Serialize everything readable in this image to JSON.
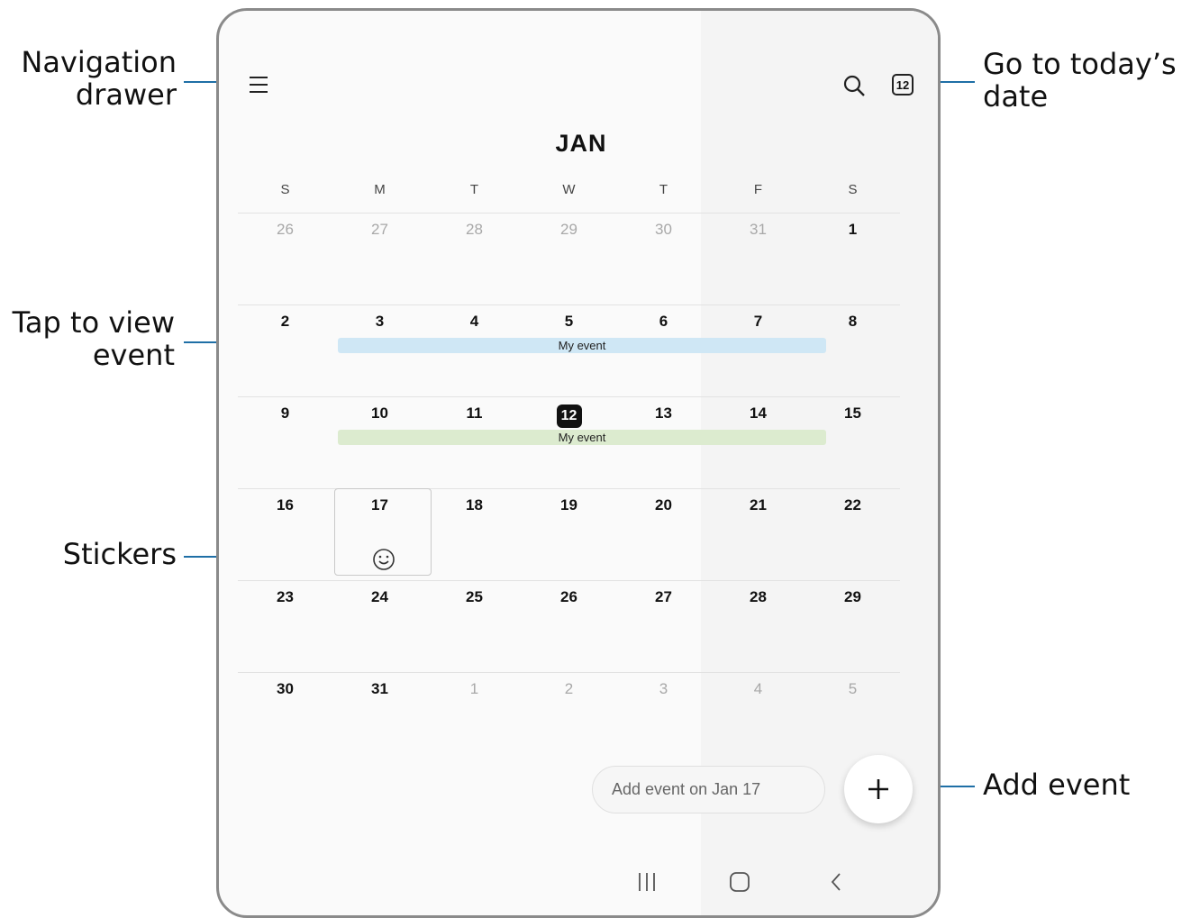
{
  "callouts": {
    "nav_drawer": [
      "Navigation",
      "drawer"
    ],
    "today": [
      "Go to today’s",
      "date"
    ],
    "view_event": [
      "Tap to view",
      "event"
    ],
    "stickers": "Stickers",
    "add_event": "Add event"
  },
  "header": {
    "menu_icon": "hamburger-menu-icon",
    "search_icon": "search-icon",
    "today_badge": "12"
  },
  "month": "JAN",
  "weekdays": [
    "S",
    "M",
    "T",
    "W",
    "T",
    "F",
    "S"
  ],
  "weeks": [
    [
      {
        "d": "26",
        "dim": true
      },
      {
        "d": "27",
        "dim": true
      },
      {
        "d": "28",
        "dim": true
      },
      {
        "d": "29",
        "dim": true
      },
      {
        "d": "30",
        "dim": true
      },
      {
        "d": "31",
        "dim": true
      },
      {
        "d": "1"
      }
    ],
    [
      {
        "d": "2"
      },
      {
        "d": "3"
      },
      {
        "d": "4"
      },
      {
        "d": "5"
      },
      {
        "d": "6"
      },
      {
        "d": "7"
      },
      {
        "d": "8"
      }
    ],
    [
      {
        "d": "9"
      },
      {
        "d": "10"
      },
      {
        "d": "11"
      },
      {
        "d": "12",
        "today": true
      },
      {
        "d": "13"
      },
      {
        "d": "14"
      },
      {
        "d": "15"
      }
    ],
    [
      {
        "d": "16"
      },
      {
        "d": "17",
        "selected": true
      },
      {
        "d": "18"
      },
      {
        "d": "19"
      },
      {
        "d": "20"
      },
      {
        "d": "21"
      },
      {
        "d": "22"
      }
    ],
    [
      {
        "d": "23"
      },
      {
        "d": "24"
      },
      {
        "d": "25"
      },
      {
        "d": "26"
      },
      {
        "d": "27"
      },
      {
        "d": "28"
      },
      {
        "d": "29"
      }
    ],
    [
      {
        "d": "30"
      },
      {
        "d": "31"
      },
      {
        "d": "1",
        "dim": true
      },
      {
        "d": "2",
        "dim": true
      },
      {
        "d": "3",
        "dim": true
      },
      {
        "d": "4",
        "dim": true
      },
      {
        "d": "5",
        "dim": true
      }
    ]
  ],
  "events": [
    {
      "title": "My event",
      "color": "#cfe7f5"
    },
    {
      "title": "My event",
      "color": "#dcebcf"
    }
  ],
  "sticker_icon": "smiley-sticker-icon",
  "add_event_placeholder": "Add event on Jan 17",
  "fab_icon": "plus-icon",
  "navbar": [
    "recent-apps-icon",
    "home-icon",
    "back-icon"
  ]
}
